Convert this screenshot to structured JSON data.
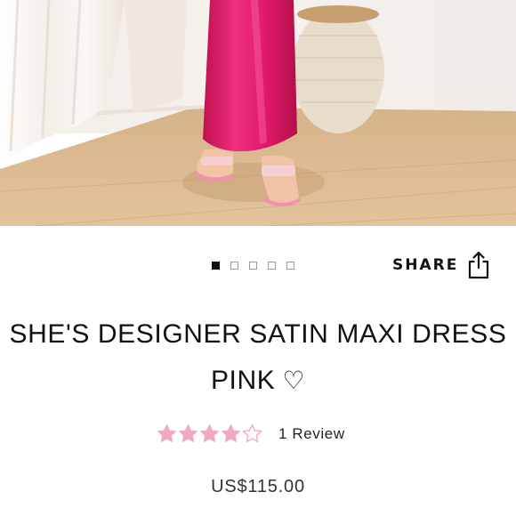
{
  "product": {
    "title_line1": "SHE'S DESIGNER SATIN MAXI DRESS",
    "title_line2": "PINK",
    "price": "US$115.00"
  },
  "gallery": {
    "image_count": 5,
    "active_index": 0,
    "image_alt": "Model wearing pink satin maxi dress with clear heeled sandals"
  },
  "share": {
    "label": "SHARE",
    "icon": "share-icon"
  },
  "wishlist": {
    "icon": "heart-outline-icon"
  },
  "rating": {
    "value": 4,
    "max": 5,
    "review_label": "1 Review",
    "star_color": "#f4a6c4"
  },
  "colors": {
    "accent_pink": "#f4a6c4",
    "dress": "#e6186e",
    "floor": "#d8b58a"
  }
}
